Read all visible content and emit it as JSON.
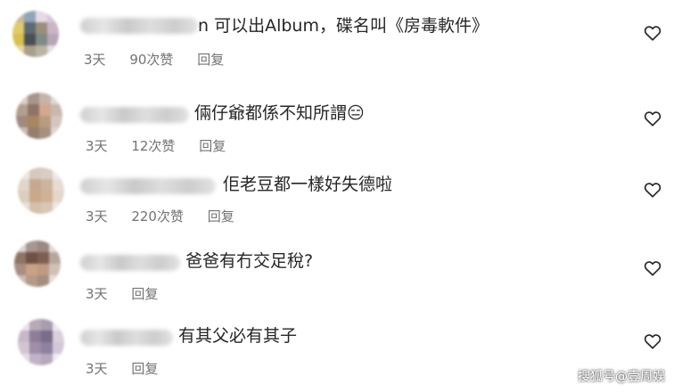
{
  "comments": [
    {
      "text": "n 可以出Album，碟名叫《房毒軟件》",
      "time": "3天",
      "likes": "90次赞",
      "reply": "回复"
    },
    {
      "text": "倆仔爺都係不知所謂😑",
      "time": "3天",
      "likes": "12次赞",
      "reply": "回复"
    },
    {
      "text": "佢老豆都一樣好失德啦",
      "time": "3天",
      "likes": "220次赞",
      "reply": "回复"
    },
    {
      "text": "爸爸有冇交足稅?",
      "time": "3天",
      "likes": "",
      "reply": "回复"
    },
    {
      "text": "有其父必有其子",
      "time": "3天",
      "likes": "",
      "reply": "回复"
    }
  ],
  "icons": {
    "like": "heart-outline-icon"
  },
  "watermark": "搜狐号@壹周娱"
}
